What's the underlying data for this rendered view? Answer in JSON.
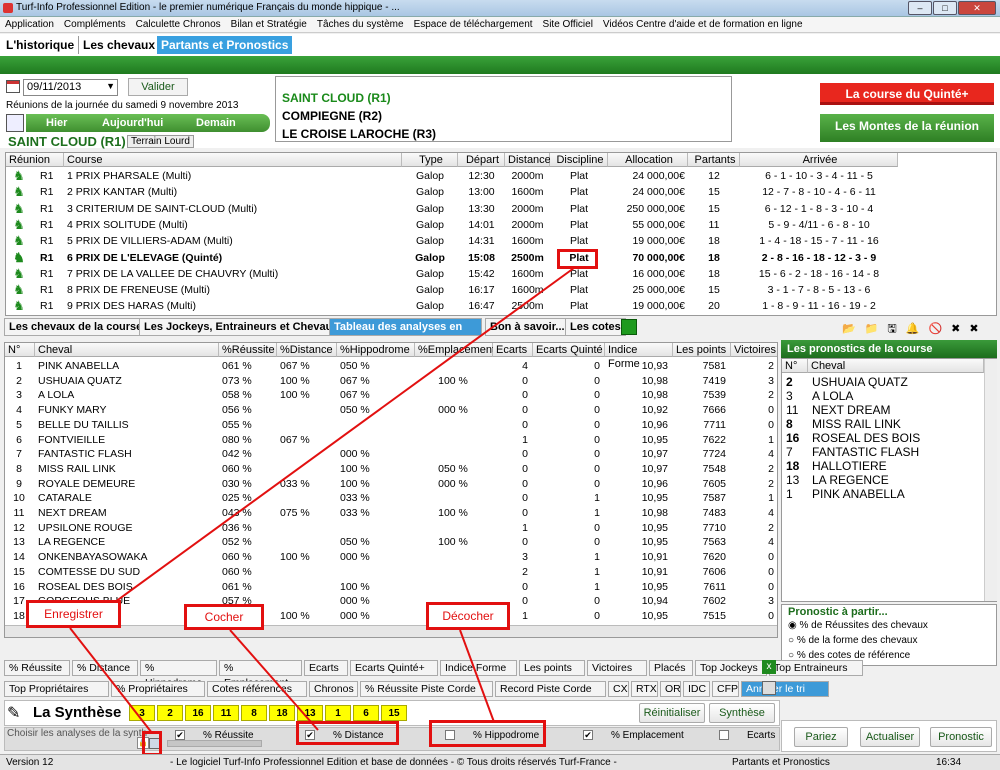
{
  "window": {
    "title": "Turf-Info Professionnel Edition - le premier numérique Français du monde hippique - ..."
  },
  "menu": [
    "Application",
    "Compléments",
    "Calculette Chronos",
    "Bilan et Stratégie",
    "Tâches du système",
    "Espace de téléchargement",
    "Site Officiel",
    "Vidéos Centre d'aide et de formation en ligne"
  ],
  "tabs": [
    "L'historique",
    "Les chevaux",
    "Partants et Pronostics"
  ],
  "date": {
    "value": "09/11/2013",
    "valider": "Valider",
    "reunions_label": "Réunions de la journée du samedi 9 novembre 2013",
    "hier": "Hier",
    "aujourdhui": "Aujourd'hui",
    "demain": "Demain"
  },
  "reunion": {
    "name": "SAINT CLOUD (R1)",
    "terrain": "Terrain Lourd"
  },
  "meetings": [
    "SAINT CLOUD (R1)",
    "COMPIEGNE (R2)",
    "LE CROISE LAROCHE (R3)"
  ],
  "right_buttons": {
    "quinte": "La course du Quinté+",
    "montes": "Les Montes de la réunion"
  },
  "races": {
    "headers": [
      "Réunion",
      "Course",
      "Type",
      "Départ",
      "Distance",
      "Discipline",
      "Allocation",
      "Partants",
      "Arrivée"
    ],
    "rows": [
      [
        "R1",
        "1 PRIX PHARSALE (Multi)",
        "Galop",
        "12:30",
        "2000m",
        "Plat",
        "24 000,00€",
        "12",
        "6 - 1 - 10 - 3 - 4 - 11 - 5"
      ],
      [
        "R1",
        "2 PRIX KANTAR (Multi)",
        "Galop",
        "13:00",
        "1600m",
        "Plat",
        "24 000,00€",
        "15",
        "12 - 7 - 8 - 10 - 4 - 6 - 11"
      ],
      [
        "R1",
        "3 CRITERIUM DE SAINT-CLOUD (Multi)",
        "Galop",
        "13:30",
        "2000m",
        "Plat",
        "250 000,00€",
        "15",
        "6 - 12 - 1 - 8 - 3 - 10 - 4"
      ],
      [
        "R1",
        "4 PRIX SOLITUDE (Multi)",
        "Galop",
        "14:01",
        "2000m",
        "Plat",
        "55 000,00€",
        "11",
        "5 - 9 - 4/11 - 6 - 8 - 10"
      ],
      [
        "R1",
        "5 PRIX DE VILLIERS-ADAM (Multi)",
        "Galop",
        "14:31",
        "1600m",
        "Plat",
        "19 000,00€",
        "18",
        "1 - 4 - 18 - 15 - 7 - 11 - 16"
      ],
      [
        "R1",
        "6 PRIX DE L'ELEVAGE (Quinté)",
        "Galop",
        "15:08",
        "2500m",
        "Plat",
        "70 000,00€",
        "18",
        "2 - 8 - 16 - 18 - 12 - 3 - 9"
      ],
      [
        "R1",
        "7 PRIX DE LA VALLEE DE CHAUVRY (Multi)",
        "Galop",
        "15:42",
        "1600m",
        "Plat",
        "16 000,00€",
        "18",
        "15 - 6 - 2 - 18 - 16 - 14 - 8"
      ],
      [
        "R1",
        "8 PRIX DE FRENEUSE (Multi)",
        "Galop",
        "16:17",
        "1600m",
        "Plat",
        "25 000,00€",
        "15",
        "3 - 1 - 7 - 8 - 5 - 13 - 6"
      ],
      [
        "R1",
        "9 PRIX DES HARAS (Multi)",
        "Galop",
        "16:47",
        "2500m",
        "Plat",
        "19 000,00€",
        "20",
        "1 - 8 - 9 - 11 - 16 - 19 - 2"
      ]
    ]
  },
  "section_tabs": [
    "Les chevaux de la course",
    "Les Jockeys, Entraineurs et Chevaux",
    "Tableau des analyses en Plat",
    "Bon à savoir...",
    "Les cotes"
  ],
  "horses": {
    "headers": [
      "N°",
      "Cheval",
      "%Réussite",
      "%Distance",
      "%Hippodrome",
      "%Emplacement",
      "Ecarts",
      "Ecarts Quinté",
      "Indice Forme",
      "Les points",
      "Victoires"
    ],
    "rows": [
      [
        "1",
        "PINK ANABELLA",
        "061 %",
        "067 %",
        "050 %",
        "",
        "4",
        "0",
        "10,93",
        "7581",
        "2"
      ],
      [
        "2",
        "USHUAIA QUATZ",
        "073 %",
        "100 %",
        "067 %",
        "100 %",
        "0",
        "0",
        "10,98",
        "7419",
        "3"
      ],
      [
        "3",
        "A LOLA",
        "058 %",
        "100 %",
        "067 %",
        "",
        "0",
        "0",
        "10,98",
        "7539",
        "2"
      ],
      [
        "4",
        "FUNKY MARY",
        "056 %",
        "",
        "050 %",
        "000 %",
        "0",
        "0",
        "10,92",
        "7666",
        "0"
      ],
      [
        "5",
        "BELLE DU TAILLIS",
        "055 %",
        "",
        "",
        "",
        "0",
        "0",
        "10,96",
        "7711",
        "0"
      ],
      [
        "6",
        "FONTVIEILLE",
        "080 %",
        "067 %",
        "",
        "",
        "1",
        "0",
        "10,95",
        "7622",
        "1"
      ],
      [
        "7",
        "FANTASTIC FLASH",
        "042 %",
        "",
        "000 %",
        "",
        "0",
        "0",
        "10,97",
        "7724",
        "4"
      ],
      [
        "8",
        "MISS RAIL LINK",
        "060 %",
        "",
        "100 %",
        "050 %",
        "0",
        "0",
        "10,97",
        "7548",
        "2"
      ],
      [
        "9",
        "ROYALE DEMEURE",
        "030 %",
        "033 %",
        "100 %",
        "000 %",
        "0",
        "0",
        "10,96",
        "7605",
        "2"
      ],
      [
        "10",
        "CATARALE",
        "025 %",
        "",
        "033 %",
        "",
        "0",
        "1",
        "10,95",
        "7587",
        "1"
      ],
      [
        "11",
        "NEXT DREAM",
        "043 %",
        "075 %",
        "033 %",
        "100 %",
        "0",
        "1",
        "10,98",
        "7483",
        "4"
      ],
      [
        "12",
        "UPSILONE ROUGE",
        "036 %",
        "",
        "",
        "",
        "1",
        "0",
        "10,95",
        "7710",
        "2"
      ],
      [
        "13",
        "LA REGENCE",
        "052 %",
        "",
        "050 %",
        "100 %",
        "0",
        "0",
        "10,95",
        "7563",
        "4"
      ],
      [
        "14",
        "ONKENBAYASOWAKA",
        "060 %",
        "100 %",
        "000 %",
        "",
        "3",
        "1",
        "10,91",
        "7620",
        "0"
      ],
      [
        "15",
        "COMTESSE DU SUD",
        "060 %",
        "",
        "",
        "",
        "2",
        "1",
        "10,91",
        "7606",
        "0"
      ],
      [
        "16",
        "ROSEAL DES BOIS",
        "061 %",
        "",
        "100 %",
        "",
        "0",
        "1",
        "10,95",
        "7611",
        "0"
      ],
      [
        "17",
        "GORGEOUS BLUE",
        "057 %",
        "",
        "000 %",
        "",
        "0",
        "0",
        "10,94",
        "7602",
        "3"
      ],
      [
        "18",
        "HALLOTIERE",
        "057 %",
        "100 %",
        "000 %",
        "100 %",
        "1",
        "0",
        "10,95",
        "7515",
        "0"
      ]
    ]
  },
  "pronostics": {
    "title": "Les pronostics de la course",
    "headers": [
      "N°",
      "Cheval"
    ],
    "rows": [
      [
        "2",
        "USHUAIA QUATZ"
      ],
      [
        "3",
        "A LOLA"
      ],
      [
        "11",
        "NEXT DREAM"
      ],
      [
        "8",
        "MISS RAIL LINK"
      ],
      [
        "16",
        "ROSEAL DES BOIS"
      ],
      [
        "7",
        "FANTASTIC FLASH"
      ],
      [
        "18",
        "HALLOTIERE"
      ],
      [
        "13",
        "LA REGENCE"
      ],
      [
        "1",
        "PINK ANABELLA"
      ]
    ],
    "bold_numbers": [
      "2",
      "8",
      "16",
      "18"
    ],
    "partir_title": "Pronostic à partir...",
    "options": [
      "% de Réussites des chevaux",
      "% de la forme des chevaux",
      "% des cotes de référence"
    ],
    "buttons": [
      "Pariez",
      "Actualiser",
      "Pronostic"
    ]
  },
  "sort_row1": [
    "% Réussite",
    "% Distance",
    "% Hippodrome",
    "% Emplacement",
    "Ecarts",
    "Ecarts Quinté+",
    "Indice Forme",
    "Les points",
    "Victoires",
    "Placés",
    "Top Jockeys",
    "Top Entraineurs"
  ],
  "sort_row2": [
    "Top Propriétaires",
    "% Propriétaires",
    "Cotes références",
    "Chronos",
    "% Réussite Piste Corde",
    "Record Piste Corde",
    "CX",
    "RTX",
    "OR",
    "IDC",
    "CFP",
    "Annuler le tri"
  ],
  "synthese": {
    "title": "La Synthèse",
    "numbers": [
      "3",
      "2",
      "16",
      "11",
      "8",
      "18",
      "13",
      "1",
      "6",
      "15"
    ],
    "reinit": "Réinitialiser",
    "synthese_btn": "Synthèse",
    "choose_label": "Choisir les analyses de la synthèse"
  },
  "checks": [
    {
      "label": "% Réussite",
      "checked": true
    },
    {
      "label": "% Distance",
      "checked": true
    },
    {
      "label": "% Hippodrome",
      "checked": false
    },
    {
      "label": "% Emplacement",
      "checked": true
    },
    {
      "label": "Ecarts",
      "checked": false
    }
  ],
  "annotations": {
    "enregistrer": "Enregistrer",
    "cocher": "Cocher",
    "decocher": "Décocher"
  },
  "status": {
    "version": "Version 12",
    "message": "- Le logiciel Turf-Info Professionnel Edition et base de données - © Tous droits réservés Turf-France -",
    "section": "Partants et Pronostics",
    "time": "16:34"
  }
}
